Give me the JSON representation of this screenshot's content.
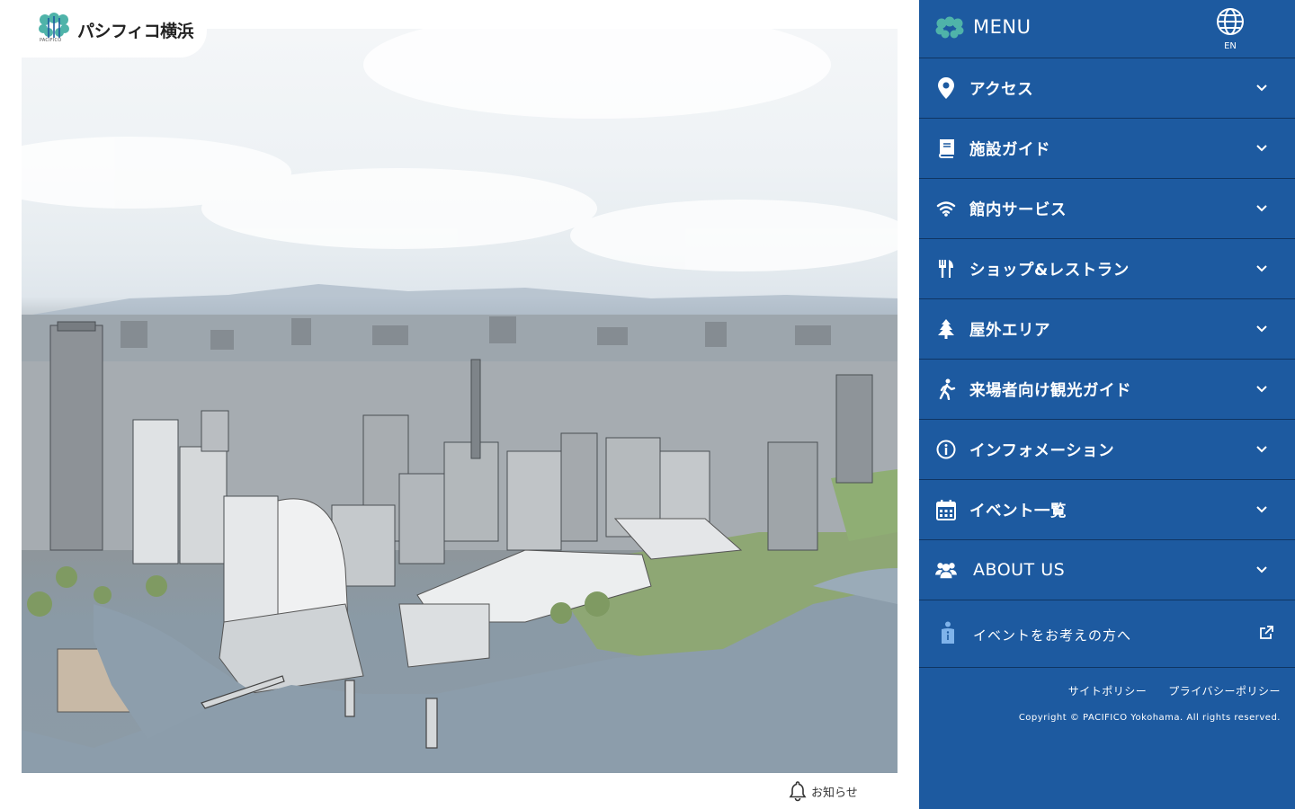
{
  "brand": {
    "name": "パシフィコ横浜",
    "sub": "PACIFICO"
  },
  "hero": {},
  "notice": {
    "label": "お知らせ"
  },
  "menu": {
    "title": "MENU",
    "lang_label": "EN",
    "items": [
      {
        "label": "アクセス",
        "icon": "map-pin-icon"
      },
      {
        "label": "施設ガイド",
        "icon": "book-icon"
      },
      {
        "label": "館内サービス",
        "icon": "wifi-icon"
      },
      {
        "label": "ショップ&レストラン",
        "icon": "fork-knife-icon"
      },
      {
        "label": "屋外エリア",
        "icon": "tree-icon"
      },
      {
        "label": "来場者向け観光ガイド",
        "icon": "walking-icon"
      },
      {
        "label": "インフォメーション",
        "icon": "info-icon"
      },
      {
        "label": "イベント一覧",
        "icon": "calendar-icon"
      },
      {
        "label": "ABOUT US",
        "icon": "users-icon"
      }
    ],
    "event_link": {
      "label": "イベントをお考えの方へ",
      "icon": "person-info-icon"
    },
    "footer_links": [
      "サイトポリシー",
      "プライバシーポリシー"
    ],
    "copyright": "Copyright © PACIFICO Yokohama. All rights reserved."
  },
  "colors": {
    "menu_bg": "#1d5aa0",
    "divider": "#0f3563",
    "accent": "#4fb3a9"
  }
}
